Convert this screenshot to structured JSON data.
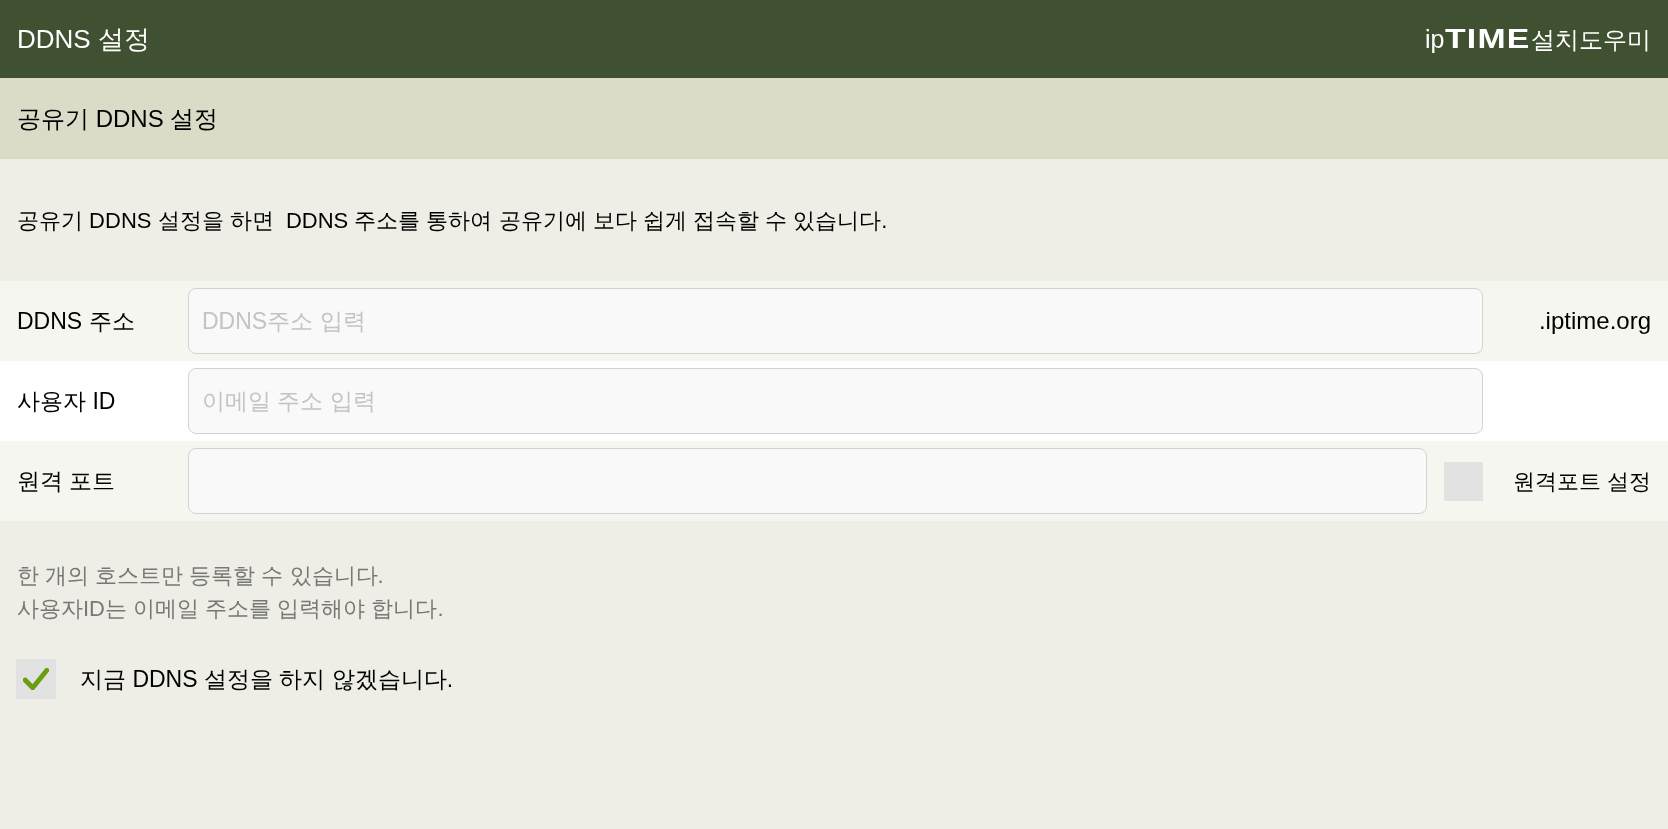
{
  "header": {
    "title": "DDNS 설정",
    "logo": {
      "prefix": "ip",
      "brand": "TIME",
      "suffix": "설치도우미"
    }
  },
  "section": {
    "title": "공유기 DDNS 설정"
  },
  "description": "공유기 DDNS 설정을 하면  DDNS 주소를 통하여 공유기에 보다 쉽게 접속할 수 있습니다.",
  "form": {
    "rows": [
      {
        "kind": "suffix",
        "label": "DDNS 주소",
        "placeholder": "DDNS주소 입력",
        "suffix": ".iptime.org"
      },
      {
        "kind": "plain",
        "label": "사용자 ID",
        "placeholder": "이메일 주소 입력"
      },
      {
        "kind": "checkbox",
        "label": "원격 포트",
        "option": {
          "label": "원격포트 설정",
          "checked": false
        }
      }
    ]
  },
  "notes": [
    "한 개의 호스트만 등록할 수 있습니다.",
    "사용자ID는 이메일 주소를 입력해야 합니다."
  ],
  "skip": {
    "label": "지금 DDNS 설정을 하지 않겠습니다.",
    "checked": true
  }
}
